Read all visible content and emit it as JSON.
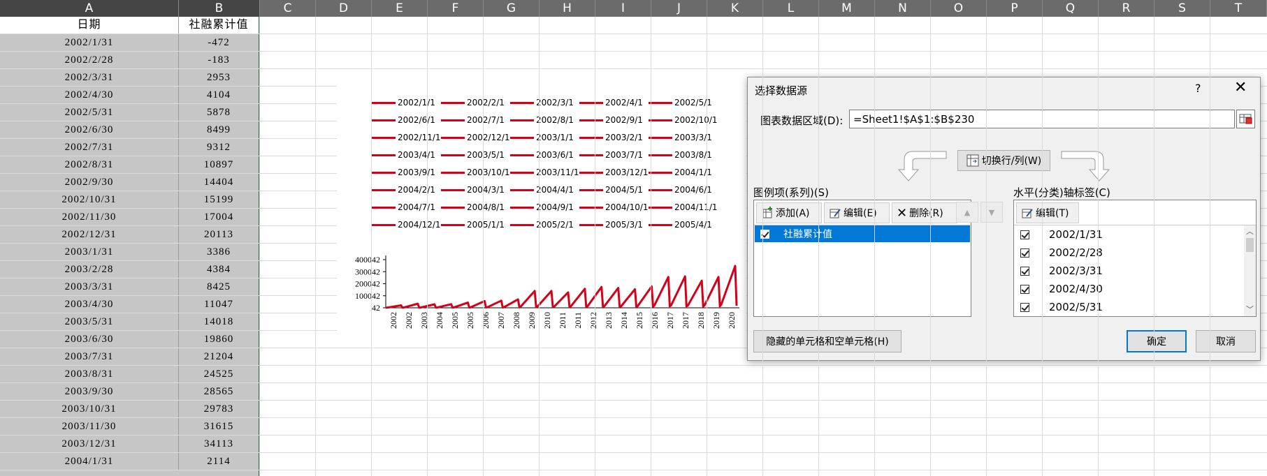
{
  "columns": [
    "A",
    "B",
    "C",
    "D",
    "E",
    "F",
    "G",
    "H",
    "I",
    "J",
    "K",
    "L",
    "M",
    "N",
    "O",
    "P",
    "Q",
    "R",
    "S",
    "T"
  ],
  "header": {
    "date": "日期",
    "value": "社融累计值"
  },
  "rows": [
    [
      "2002/1/31",
      "-472"
    ],
    [
      "2002/2/28",
      "-183"
    ],
    [
      "2002/3/31",
      "2953"
    ],
    [
      "2002/4/30",
      "4104"
    ],
    [
      "2002/5/31",
      "5878"
    ],
    [
      "2002/6/30",
      "8499"
    ],
    [
      "2002/7/31",
      "9312"
    ],
    [
      "2002/8/31",
      "10897"
    ],
    [
      "2002/9/30",
      "14404"
    ],
    [
      "2002/10/31",
      "15199"
    ],
    [
      "2002/11/30",
      "17004"
    ],
    [
      "2002/12/31",
      "20113"
    ],
    [
      "2003/1/31",
      "3386"
    ],
    [
      "2003/2/28",
      "4384"
    ],
    [
      "2003/3/31",
      "8425"
    ],
    [
      "2003/4/30",
      "11047"
    ],
    [
      "2003/5/31",
      "14018"
    ],
    [
      "2003/6/30",
      "19860"
    ],
    [
      "2003/7/31",
      "21204"
    ],
    [
      "2003/8/31",
      "24525"
    ],
    [
      "2003/9/30",
      "28565"
    ],
    [
      "2003/10/31",
      "29783"
    ],
    [
      "2003/11/30",
      "31615"
    ],
    [
      "2003/12/31",
      "34113"
    ],
    [
      "2004/1/31",
      "2114"
    ]
  ],
  "chart_data": {
    "type": "line",
    "legend": [
      "2002/1/1",
      "2002/2/1",
      "2002/3/1",
      "2002/4/1",
      "2002/5/1",
      "2002/6/1",
      "2002/7/1",
      "2002/8/1",
      "2002/9/1",
      "2002/10/1",
      "2002/11/1",
      "2002/12/1",
      "2003/1/1",
      "2003/2/1",
      "2003/3/1",
      "2003/4/1",
      "2003/5/1",
      "2003/6/1",
      "2003/7/1",
      "2003/8/1",
      "2003/9/1",
      "2003/10/1",
      "2003/11/1",
      "2003/12/1",
      "2004/1/1",
      "2004/2/1",
      "2004/3/1",
      "2004/4/1",
      "2004/5/1",
      "2004/6/1",
      "2004/7/1",
      "2004/8/1",
      "2004/9/1",
      "2004/10/1",
      "2004/11/1",
      "2004/12/1",
      "2005/1/1",
      "2005/2/1",
      "2005/3/1",
      "2005/4/1"
    ],
    "y_ticks": [
      "400042",
      "300042",
      "200042",
      "100042",
      "42"
    ],
    "ylim": [
      42,
      400042
    ],
    "x_ticks": [
      "2002",
      "2002",
      "2003",
      "2004",
      "2005",
      "2005",
      "2006",
      "2007",
      "2008",
      "2009",
      "2010",
      "2011",
      "2011",
      "2012",
      "2013",
      "2014",
      "2015",
      "2016",
      "2017",
      "2017",
      "2018",
      "2019",
      "2020"
    ],
    "series_color": "#d50018",
    "annual_peaks": [
      20113,
      34113,
      29000,
      30000,
      43000,
      56000,
      59000,
      70000,
      140000,
      140000,
      128000,
      158000,
      173000,
      165000,
      154000,
      178000,
      256000,
      261000,
      225000,
      256000,
      348000
    ]
  },
  "dialog": {
    "title": "选择数据源",
    "help": "?",
    "close": "✕",
    "range_label": "图表数据区域(D):",
    "range_value": "=Sheet1!$A$1:$B$230",
    "switch_label": "切换行/列(W)",
    "legend_label": "图例项(系列)(S)",
    "add": "添加(A)",
    "edit": "编辑(E)",
    "delete": "删除(R)",
    "series": [
      "社融累计值"
    ],
    "axis_label": "水平(分类)轴标签(C)",
    "axis_edit": "编辑(T)",
    "axis_items": [
      "2002/1/31",
      "2002/2/28",
      "2002/3/31",
      "2002/4/30",
      "2002/5/31"
    ],
    "hidden_cells": "隐藏的单元格和空单元格(H)",
    "ok": "确定",
    "cancel": "取消"
  }
}
